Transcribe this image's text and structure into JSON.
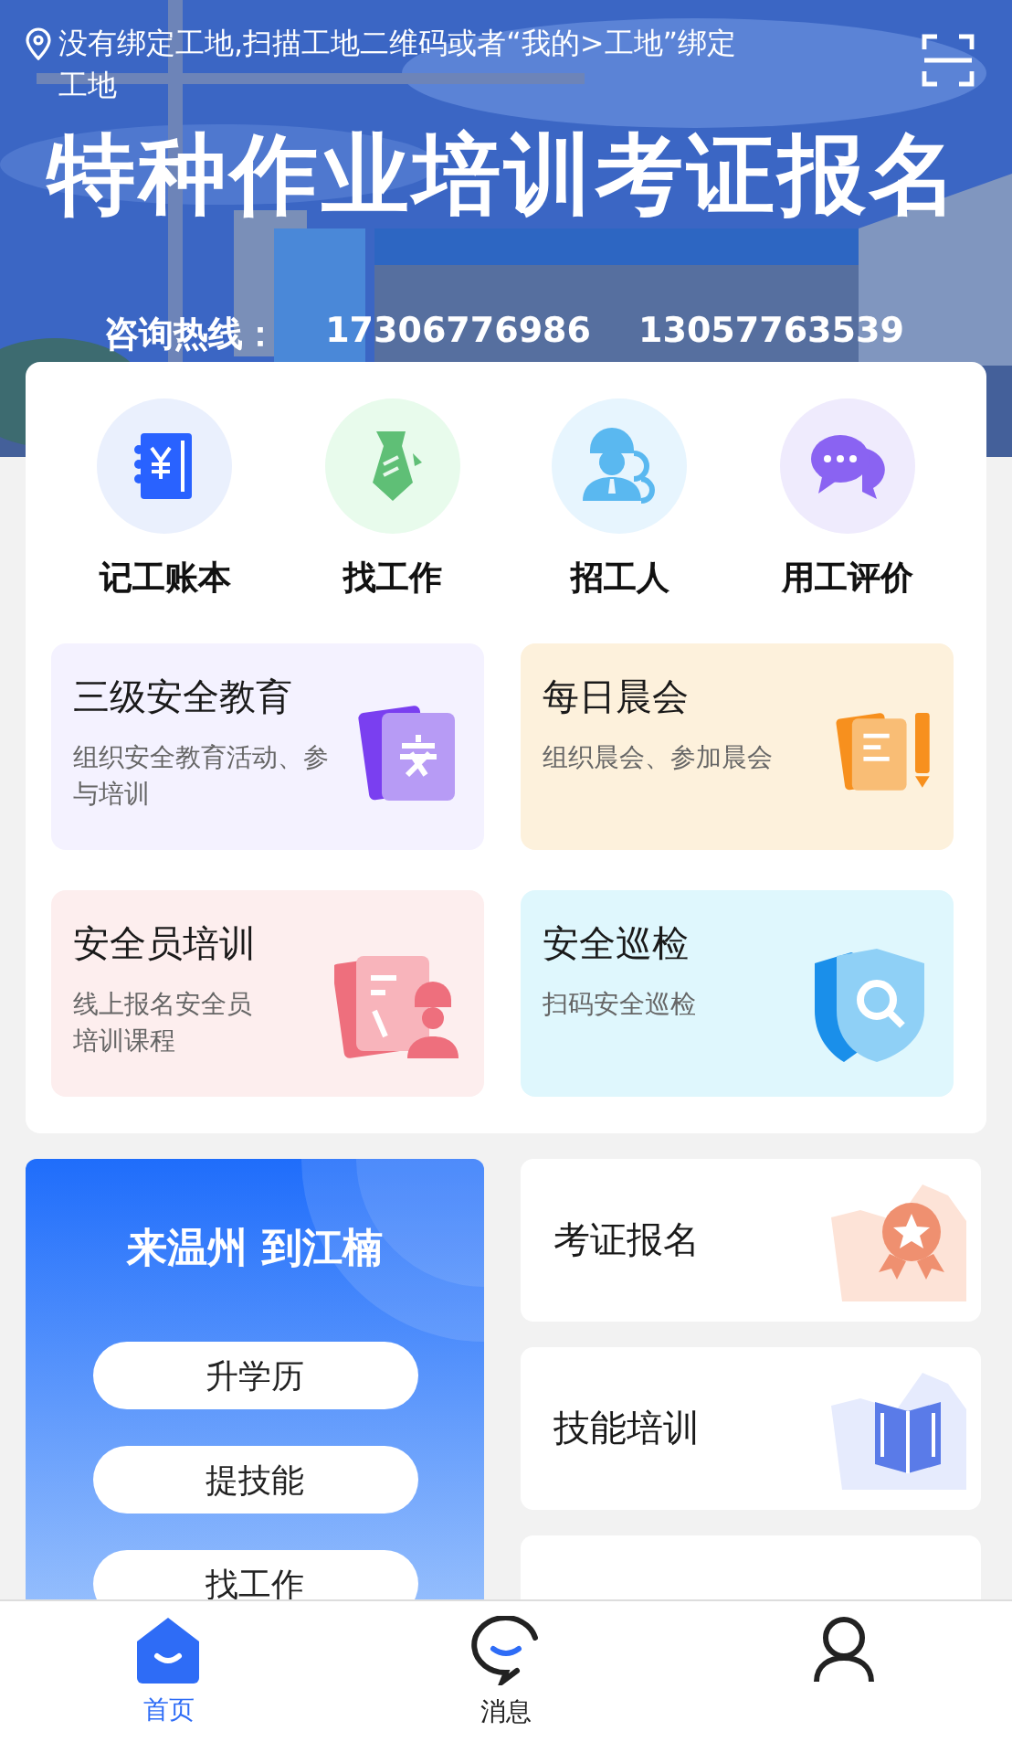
{
  "header": {
    "location_notice": "没有绑定工地,扫描工地二维码或者“我的>工地”绑定工地",
    "banner_title": "特种作业培训考证报名",
    "hotline_label": "咨询热线：",
    "hotlines": [
      "17306776986",
      "13057763539"
    ]
  },
  "quick_actions": [
    {
      "label": "记工账本",
      "kind": "ledger"
    },
    {
      "label": "找工作",
      "kind": "job"
    },
    {
      "label": "招工人",
      "kind": "hire"
    },
    {
      "label": "用工评价",
      "kind": "review"
    }
  ],
  "feature_cards": [
    {
      "title": "三级安全教育",
      "description": "组织安全教育活动、参与培训",
      "kind": "education"
    },
    {
      "title": "每日晨会",
      "description": "组织晨会、参加晨会",
      "kind": "meeting"
    },
    {
      "title": "安全员培训",
      "description": "线上报名安全员培训课程",
      "kind": "training"
    },
    {
      "title": "安全巡检",
      "description": "扫码安全巡检",
      "kind": "patrol"
    }
  ],
  "promo": {
    "title": "来温州 到江楠",
    "buttons": [
      "升学历",
      "提技能",
      "找工作"
    ]
  },
  "services": [
    {
      "title": "考证报名",
      "kind": "certificate"
    },
    {
      "title": "技能培训",
      "kind": "book"
    },
    {
      "kind": "blank"
    }
  ],
  "tab_bar": [
    {
      "label": "首页",
      "selected": true,
      "kind": "home"
    },
    {
      "label": "消息",
      "selected": false,
      "kind": "message"
    },
    {
      "selected": false,
      "kind": "profile"
    }
  ]
}
